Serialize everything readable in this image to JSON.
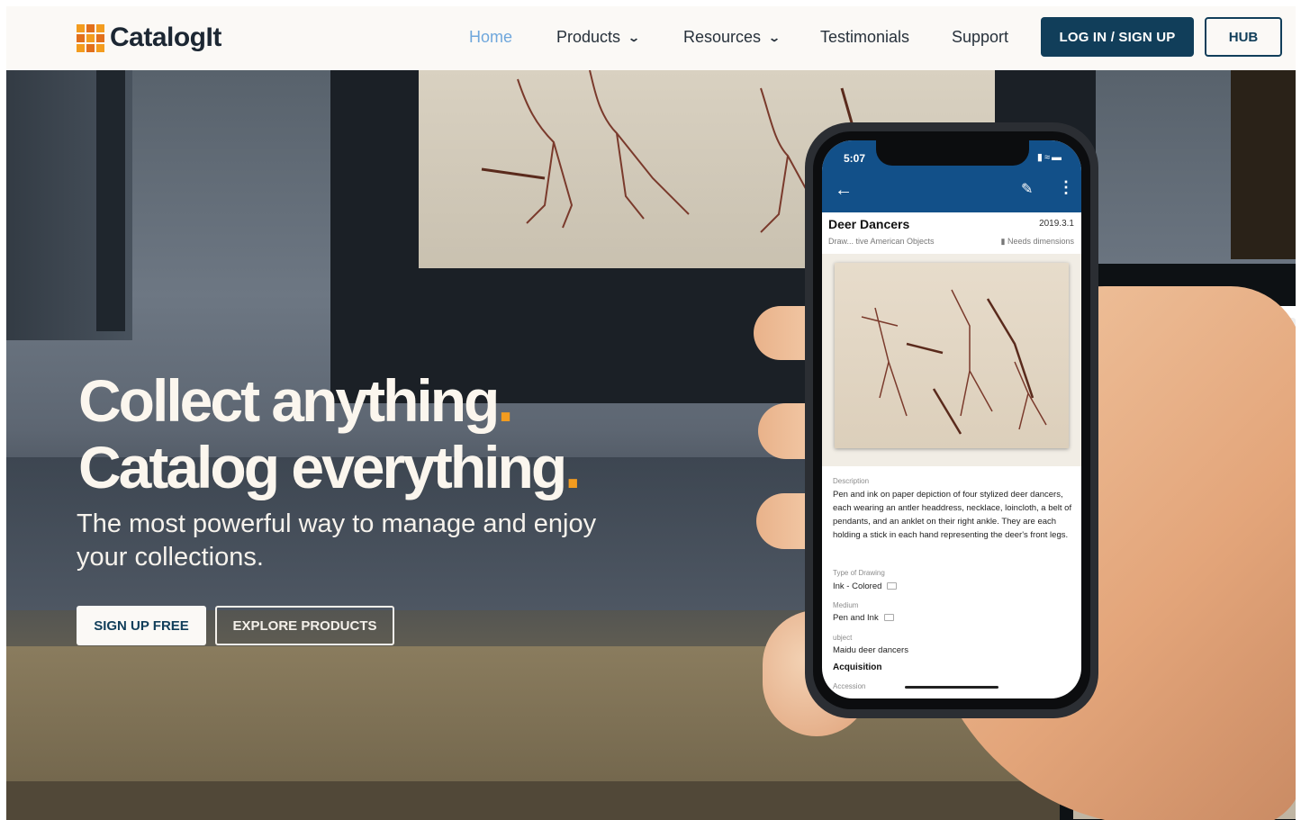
{
  "brand": {
    "name": "CatalogIt",
    "accent": "#f39c1f",
    "primary": "#113e5a"
  },
  "nav": {
    "items": [
      {
        "label": "Home",
        "active": true
      },
      {
        "label": "Products",
        "dropdown": true
      },
      {
        "label": "Resources",
        "dropdown": true
      },
      {
        "label": "Testimonials"
      },
      {
        "label": "Support"
      }
    ],
    "login_label": "LOG IN / SIGN UP",
    "hub_label": "HUB"
  },
  "hero": {
    "line1": "Collect anything",
    "line2": "Catalog everything",
    "dot": ".",
    "subtitle": "The most powerful way to manage and enjoy your collections.",
    "signup_label": "SIGN UP FREE",
    "explore_label": "EXPLORE PRODUCTS"
  },
  "phone": {
    "time": "5:07",
    "record_title": "Deer Dancers",
    "record_number": "2019.3.1",
    "record_meta": "Draw...    tive American Objects",
    "record_warning": "Needs dimensions",
    "fields": {
      "description_label": "Description",
      "description": "Pen and ink on paper depiction of four stylized deer dancers, each wearing an antler headdress, necklace, loincloth, a belt of pendants, and an anklet on their right ankle.  They are each holding a stick in each hand representing the deer's front legs.",
      "type_label": "Type of Drawing",
      "type": "Ink - Colored",
      "medium_label": "Medium",
      "medium": "Pen and Ink",
      "subject_label": "ubject",
      "subject": "Maidu deer dancers",
      "acquisition": "Acquisition",
      "accession_label": "Accession"
    }
  }
}
